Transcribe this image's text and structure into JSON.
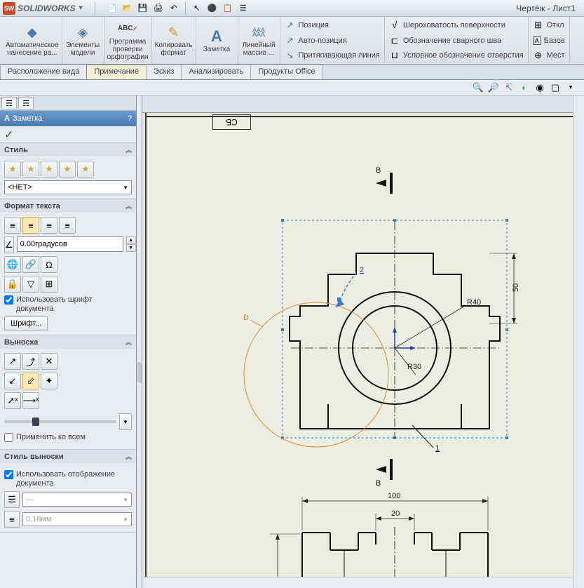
{
  "app_title": "SOLIDWORKS",
  "document_title": "Чертёж - Лист1",
  "ribbon_groups": [
    {
      "label": "Автоматическое\nнанесение ра...",
      "icon": "◆"
    },
    {
      "label": "Элементы\nмодели",
      "icon": "◈"
    },
    {
      "label": "Программа\nпроверки\nорфографии",
      "icon": "ABC"
    },
    {
      "label": "Копировать\nформат",
      "icon": "✎"
    },
    {
      "label": "Заметка",
      "icon": "A"
    },
    {
      "label": "Линейный\nмассив ...",
      "icon": "AAA"
    }
  ],
  "ribbon_right": [
    {
      "icon": "↗",
      "label": "Позиция"
    },
    {
      "icon": "↗",
      "label": "Авто-позиция"
    },
    {
      "icon": "↘",
      "label": "Притягивающая линия"
    }
  ],
  "ribbon_right2": [
    {
      "icon": "√",
      "label": "Шероховатость поверхности"
    },
    {
      "icon": "⊏",
      "label": "Обозначение сварного шва"
    },
    {
      "icon": "⊔",
      "label": "Условное обозначение отверстия"
    }
  ],
  "ribbon_right3": [
    {
      "icon": "⊞",
      "label": "Откл"
    },
    {
      "icon": "A",
      "label": "Базов"
    },
    {
      "icon": "⊕",
      "label": "Мест"
    }
  ],
  "tabs": [
    {
      "label": "Расположение вида",
      "active": false
    },
    {
      "label": "Примечание",
      "active": true
    },
    {
      "label": "Эскиз",
      "active": false
    },
    {
      "label": "Анализировать",
      "active": false
    },
    {
      "label": "Продукты Office",
      "active": false
    }
  ],
  "panel": {
    "title": "Заметка",
    "style": {
      "title": "Стиль",
      "combo": "<НЕТ>"
    },
    "text_format": {
      "title": "Формат текста",
      "angle": "0.00градусов",
      "use_doc_font_label": "Использовать шрифт документа",
      "font_btn": "Шрифт..."
    },
    "leader": {
      "title": "Выноска",
      "apply_all_label": "Применить ко всем"
    },
    "leader_style": {
      "title": "Стиль выноски",
      "use_doc_display_label": "Использовать отображение документа",
      "thickness_value": "0.18мм"
    }
  },
  "drawing": {
    "detail_label": "D",
    "section_label": "B",
    "balloon_1": "1",
    "balloon_2": "2",
    "dim_r40": "R40",
    "dim_r30": "R30",
    "dim_50": "50",
    "dim_100": "100",
    "dim_20": "20",
    "cb_label": "СБ"
  }
}
